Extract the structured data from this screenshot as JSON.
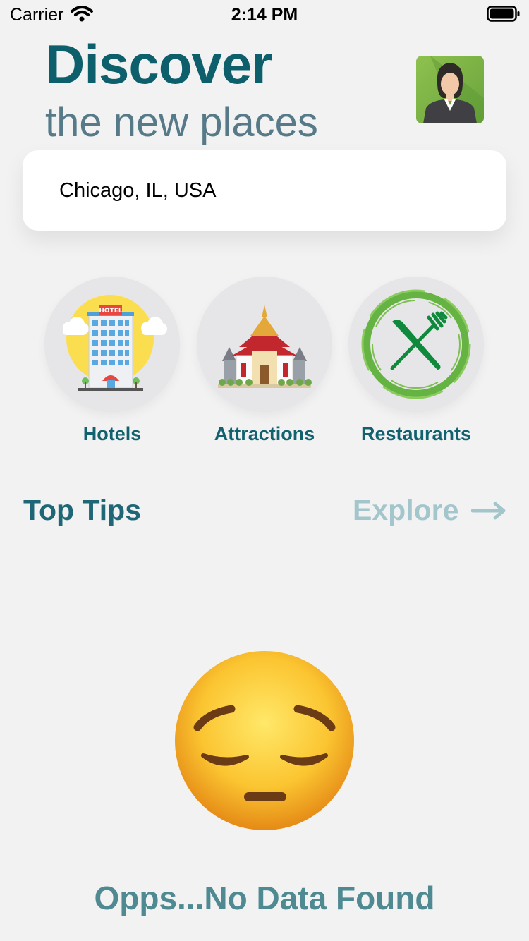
{
  "status_bar": {
    "carrier": "Carrier",
    "time": "2:14 PM"
  },
  "header": {
    "title": "Discover",
    "subtitle": "the new places"
  },
  "search": {
    "value": "Chicago, IL, USA"
  },
  "categories": [
    {
      "label": "Hotels",
      "icon": "hotel-icon"
    },
    {
      "label": "Attractions",
      "icon": "temple-icon"
    },
    {
      "label": "Restaurants",
      "icon": "fork-knife-icon"
    }
  ],
  "hotel_sign": "HOTEL",
  "tips": {
    "title": "Top Tips",
    "explore_label": "Explore"
  },
  "empty_state": {
    "icon": "pensive-face-icon",
    "message": "Opps...No Data Found"
  },
  "colors": {
    "primary": "#0e5f6c",
    "subtitle": "#567a87",
    "explore": "#a3c6cc",
    "background": "#f2f2f2"
  }
}
